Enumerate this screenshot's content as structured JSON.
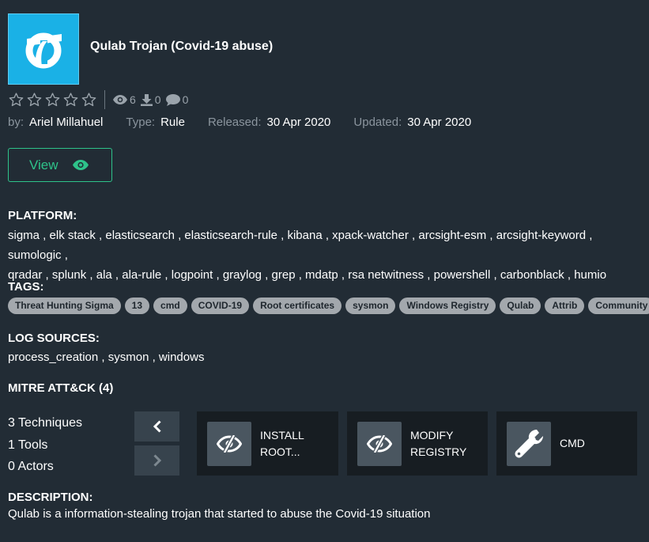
{
  "header": {
    "title": "Qulab Trojan (Covid-19 abuse)"
  },
  "stats": {
    "rating_stars": 0,
    "rating_max": 5,
    "views": "6",
    "downloads": "0",
    "comments": "0"
  },
  "meta": {
    "by_label": "by:",
    "by_value": "Ariel Millahuel",
    "type_label": "Type:",
    "type_value": "Rule",
    "released_label": "Released:",
    "released_value": "30 Apr 2020",
    "updated_label": "Updated:",
    "updated_value": "30 Apr 2020"
  },
  "view_button": {
    "label": "View"
  },
  "platform": {
    "heading": "PLATFORM:",
    "line1": "sigma , elk stack , elasticsearch , elasticsearch-rule , kibana , xpack-watcher , arcsight-esm , arcsight-keyword , sumologic ,",
    "line2": "qradar , splunk , ala , ala-rule , logpoint , graylog , grep , mdatp , rsa netwitness , powershell , carbonblack , humio"
  },
  "tags": {
    "heading": "TAGS:",
    "items": [
      "Threat Hunting Sigma",
      "13",
      "cmd",
      "COVID-19",
      "Root certificates",
      "sysmon",
      "Windows Registry",
      "Qulab",
      "Attrib",
      "Community"
    ]
  },
  "log_sources": {
    "heading": "LOG SOURCES:",
    "text": "process_creation , sysmon , windows"
  },
  "mitre": {
    "heading": "MITRE ATT&CK (4)",
    "techniques": "3 Techniques",
    "tools": "1 Tools",
    "actors": "0 Actors",
    "cards": [
      {
        "label": "INSTALL\nROOT...",
        "icon": "eye-slash-icon"
      },
      {
        "label": "MODIFY\nREGISTRY",
        "icon": "eye-slash-icon"
      },
      {
        "label": "CMD",
        "icon": "wrench-icon"
      }
    ]
  },
  "description": {
    "heading": "DESCRIPTION:",
    "text": "Qulab is a information-stealing trojan that started to abuse the Covid-19 situation"
  },
  "colors": {
    "background": "#222c35",
    "accent_green": "#2ec38a",
    "logo_blue": "#1ab1e6",
    "tag_bg": "#a3a8ad",
    "card_bg": "#171d22"
  }
}
